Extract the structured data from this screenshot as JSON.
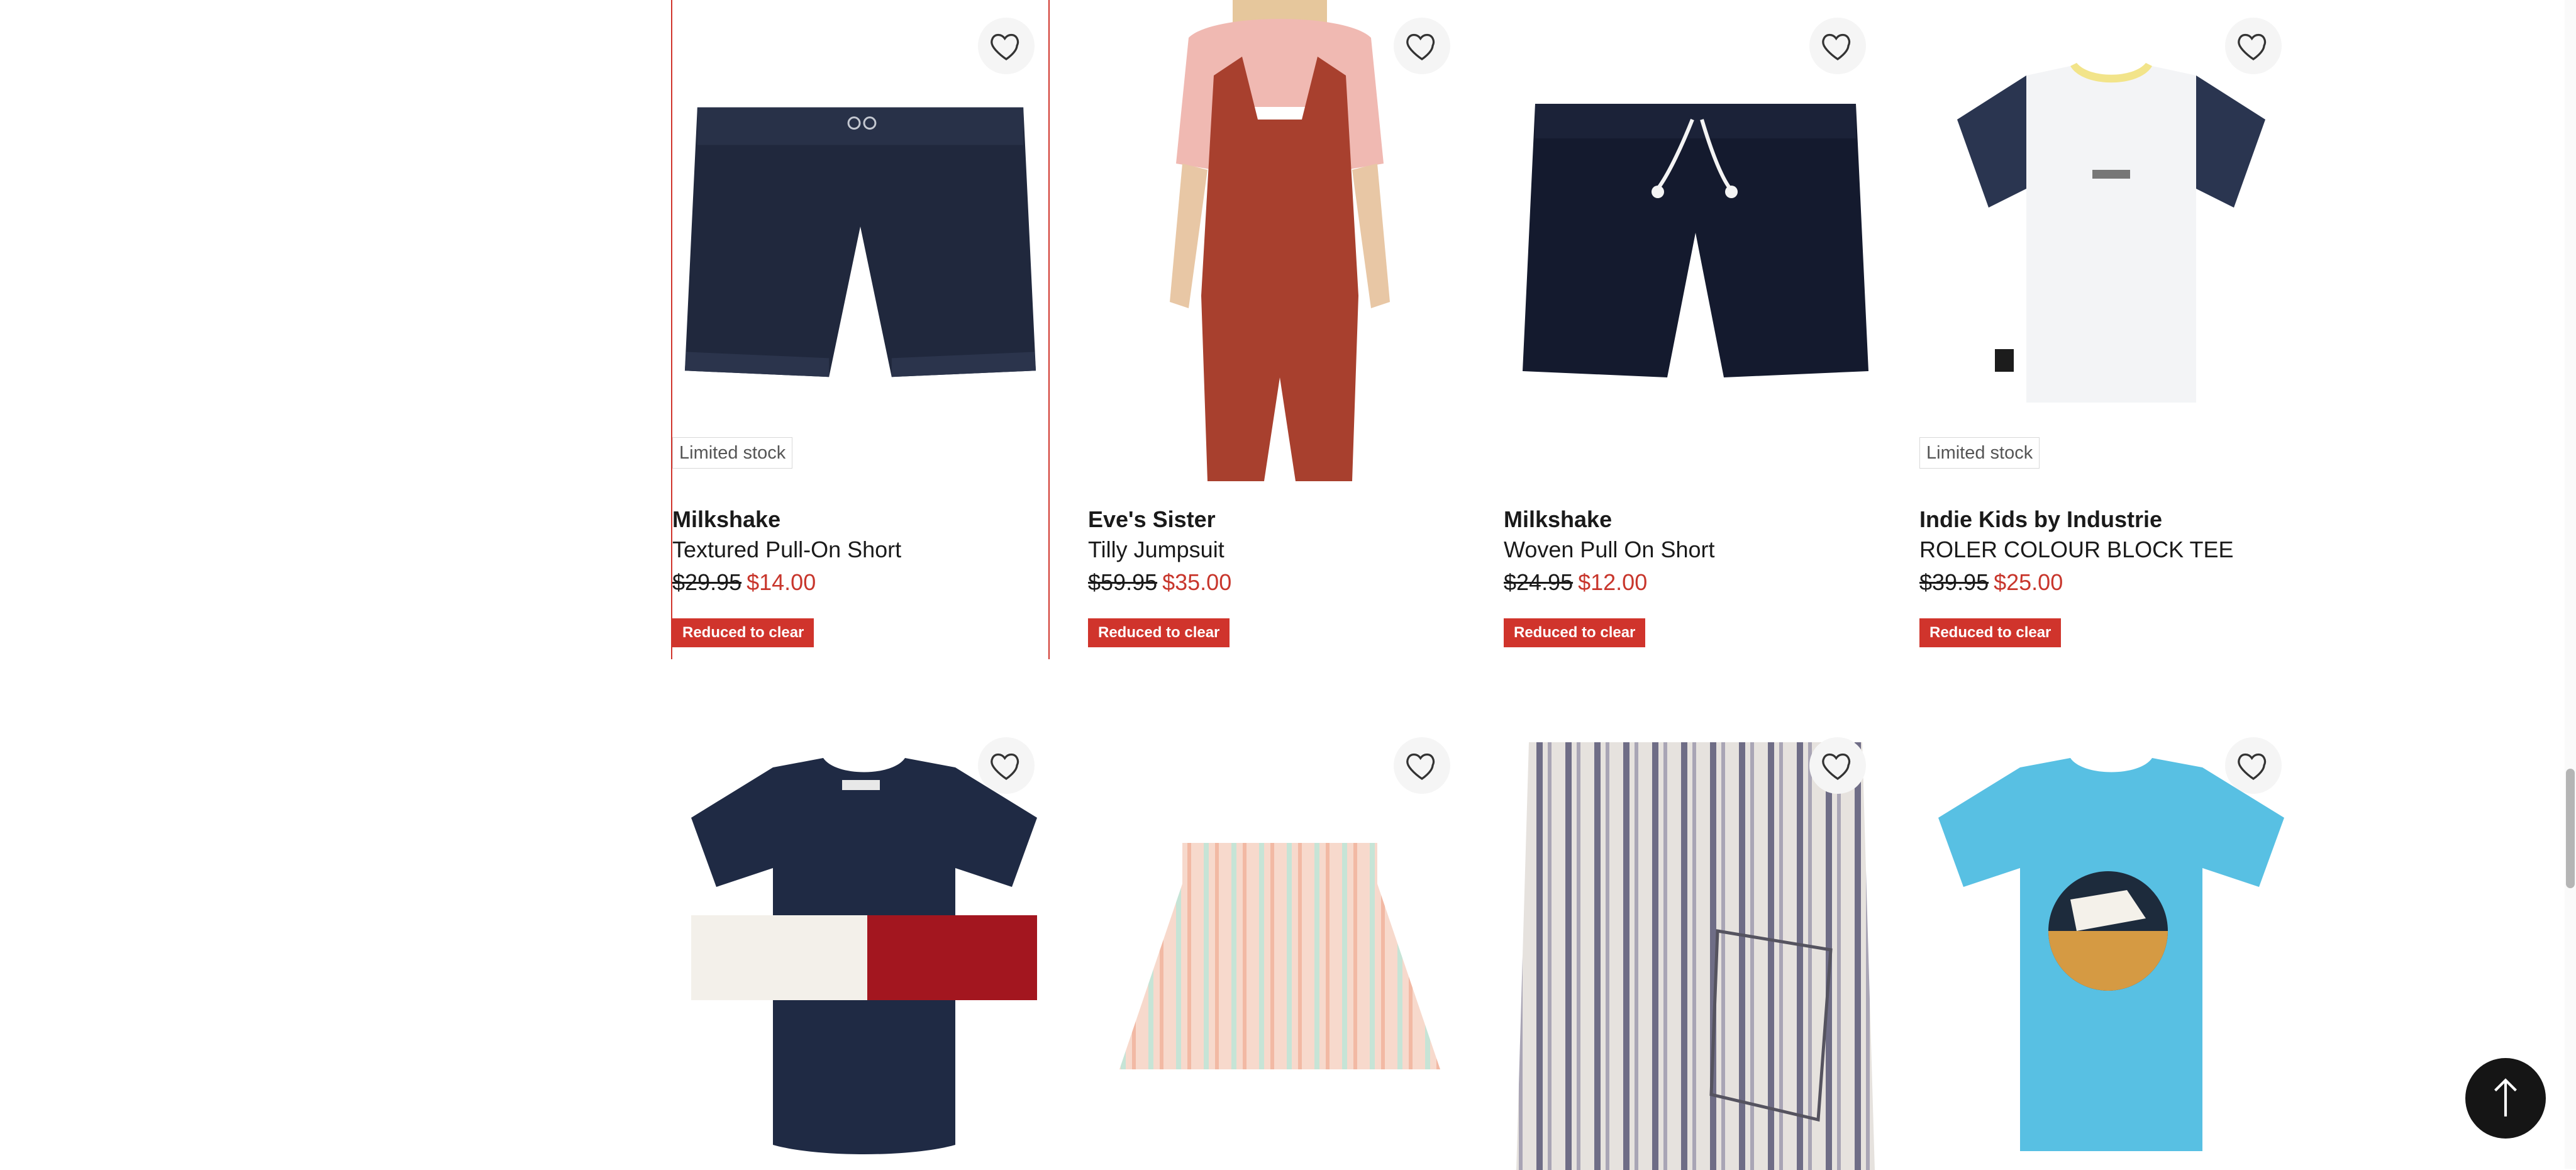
{
  "products": [
    {
      "brand": "Milkshake",
      "name": "Textured Pull-On Short",
      "was_price": "$29.95",
      "now_price": "$14.00",
      "stock_badge": "Limited stock",
      "promo_badge": "Reduced to clear",
      "image_icon": "navy-pull-on-shorts-image"
    },
    {
      "brand": "Eve's Sister",
      "name": "Tilly Jumpsuit",
      "was_price": "$59.95",
      "now_price": "$35.00",
      "promo_badge": "Reduced to clear",
      "image_icon": "rust-overall-jumpsuit-image"
    },
    {
      "brand": "Milkshake",
      "name": "Woven Pull On Short",
      "was_price": "$24.95",
      "now_price": "$12.00",
      "promo_badge": "Reduced to clear",
      "image_icon": "navy-woven-shorts-image"
    },
    {
      "brand": "Indie Kids by Industrie",
      "name": "ROLER COLOUR BLOCK TEE",
      "was_price": "$39.95",
      "now_price": "$25.00",
      "stock_badge": "Limited stock",
      "promo_badge": "Reduced to clear",
      "image_icon": "white-navy-tee-image"
    }
  ],
  "second_row": [
    {
      "image_icon": "navy-flag-tee-image"
    },
    {
      "image_icon": "pastel-stripe-skirt-image"
    },
    {
      "image_icon": "striped-linen-shorts-image"
    },
    {
      "image_icon": "aqua-graphic-tee-image"
    }
  ],
  "controls": {
    "wishlist_icon": "heart-icon",
    "back_to_top_icon": "arrow-up-icon"
  },
  "colors": {
    "accent_red": "#d0342c",
    "price_red": "#c8362c",
    "navy": "#1f2a44"
  }
}
